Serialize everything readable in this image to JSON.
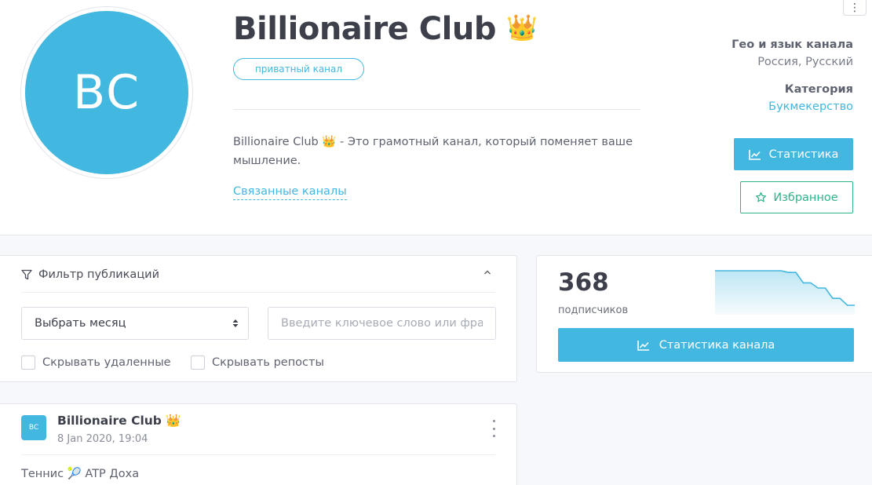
{
  "channel": {
    "avatar_initials": "BC",
    "title": "Billionaire Club",
    "title_emoji": "👑",
    "badge": "приватный канал",
    "description": "Billionaire Club 👑 - Это грамотный канал, который поменяет ваше мышление.",
    "related_link": "Связанные каналы"
  },
  "meta": {
    "geo_label": "Гео и язык канала",
    "geo_value": "Россия, Русский",
    "category_label": "Категория",
    "category_value": "Букмекерство"
  },
  "actions": {
    "stats_button": "Статистика",
    "favorite_button": "Избранное",
    "more_menu": "⋮"
  },
  "filter": {
    "title": "Фильтр публикаций",
    "month_select": "Выбрать месяц",
    "search_placeholder": "Введите ключевое слово или фразу",
    "hide_deleted": "Скрывать удаленные",
    "hide_reposts": "Скрывать репосты"
  },
  "subscribers": {
    "count": "368",
    "label": "подписчиков",
    "channel_stats_button": "Статистика канала",
    "sparkline_trend": [
      100,
      100,
      100,
      100,
      100,
      100,
      100,
      100,
      100,
      100,
      98,
      98,
      86,
      86,
      80,
      80,
      68,
      68,
      60,
      60
    ]
  },
  "post": {
    "avatar_initials": "BC",
    "author": "Billionaire Club",
    "author_emoji": "👑",
    "date": "8 Jan 2020, 19:04",
    "text": "Теннис 🎾 ATP Доха"
  },
  "colors": {
    "accent": "#42b7df",
    "favorite": "#2fb38a",
    "background": "#f7f8fb"
  },
  "icons": {
    "stats": "chart-line-icon",
    "favorite": "star-icon",
    "filter": "filter-funnel-icon",
    "collapse": "chevron-up-icon",
    "select": "sort-arrows-icon",
    "menu": "vertical-dots-icon"
  }
}
